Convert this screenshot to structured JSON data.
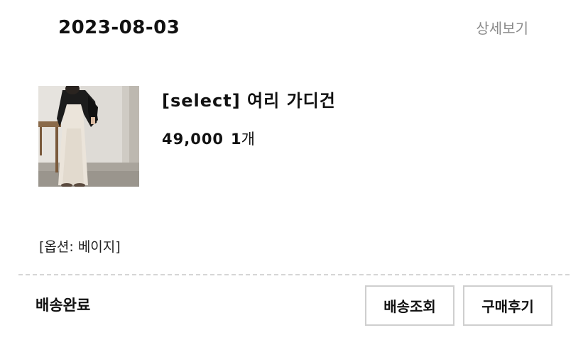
{
  "order": {
    "date": "2023-08-03",
    "detail_link": "상세보기"
  },
  "product": {
    "name": "[select] 여리 가디건",
    "price": "49,000",
    "quantity_number": "1",
    "quantity_unit": "개",
    "option": "[옵션: 베이지]",
    "image_icon": "product-photo"
  },
  "status": {
    "label": "배송완료"
  },
  "actions": {
    "track_label": "배송조회",
    "review_label": "구매후기"
  },
  "colors": {
    "text": "#111111",
    "link_gray": "#8a8a8a",
    "border": "#cfcfcf",
    "divider": "#d6d6d6"
  }
}
